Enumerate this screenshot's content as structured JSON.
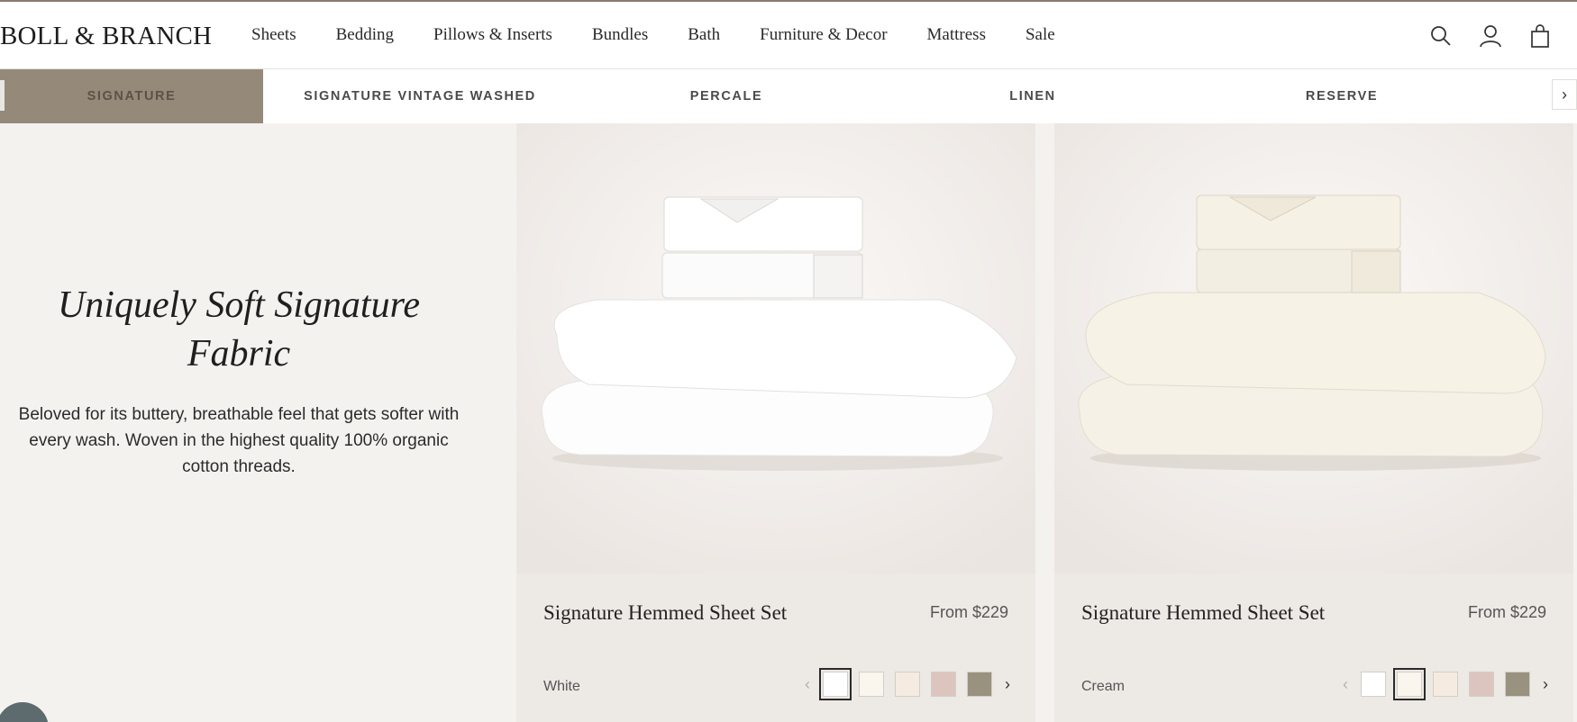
{
  "header": {
    "logo": "BOLL & BRANCH",
    "nav": [
      "Sheets",
      "Bedding",
      "Pillows & Inserts",
      "Bundles",
      "Bath",
      "Furniture & Decor",
      "Mattress",
      "Sale"
    ],
    "icons": [
      "search-icon",
      "account-icon",
      "cart-icon"
    ]
  },
  "tabs": {
    "items": [
      "SIGNATURE",
      "SIGNATURE VINTAGE WASHED",
      "PERCALE",
      "LINEN",
      "RESERVE"
    ],
    "active_index": 0,
    "next_glyph": "›"
  },
  "intro": {
    "title": "Uniquely Soft Signature Fabric",
    "body": "Beloved for its buttery, breathable feel that gets softer with every wash. Woven in the highest quality 100% organic cotton threads."
  },
  "products": [
    {
      "name": "Signature Hemmed Sheet Set",
      "price": "From $229",
      "color_label": "White",
      "swatches": [
        "#ffffff",
        "#faf6ee",
        "#f5ebe0",
        "#dcc5bf",
        "#98927f"
      ],
      "selected_swatch": 0,
      "image_tone": "#ffffff"
    },
    {
      "name": "Signature Hemmed Sheet Set",
      "price": "From $229",
      "color_label": "Cream",
      "swatches": [
        "#ffffff",
        "#faf6ee",
        "#f5ebe0",
        "#dcc5bf",
        "#98927f"
      ],
      "selected_swatch": 1,
      "image_tone": "#f3efe2"
    }
  ],
  "colors": {
    "accent_tab": "#958979",
    "card_bg": "#ede9e5",
    "page_bg": "#f4f2ef"
  }
}
